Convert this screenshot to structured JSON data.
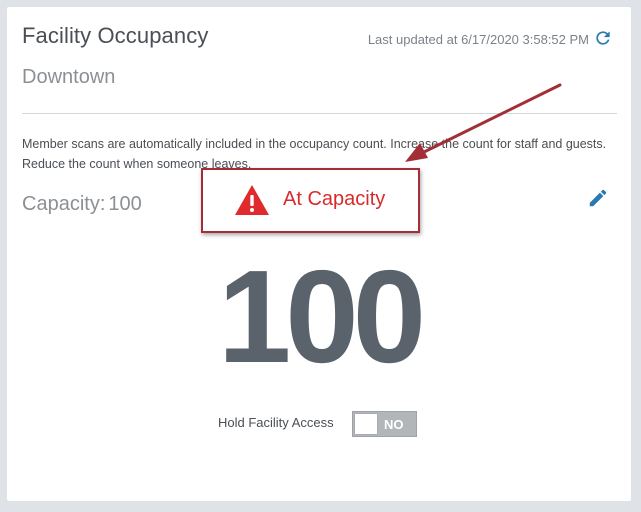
{
  "header": {
    "title": "Facility Occupancy",
    "last_updated": "Last updated at 6/17/2020 3:58:52 PM",
    "location": "Downtown"
  },
  "description": "Member scans are automatically included in the occupancy count. Increase the count for staff and guests. Reduce the count when someone leaves.",
  "capacity": {
    "label": "Capacity:",
    "value": "100"
  },
  "alert": {
    "text": "At Capacity",
    "color": "#d82a2a"
  },
  "occupancy": {
    "count": "100"
  },
  "hold_access": {
    "label": "Hold Facility Access",
    "toggle_text": "NO"
  },
  "icons": {
    "refresh": "refresh-icon",
    "edit": "pencil-icon",
    "warning": "warning-triangle-icon"
  },
  "colors": {
    "accent": "#2a7ab0",
    "alert_red": "#d82a2a",
    "annotation": "#a32e35"
  }
}
